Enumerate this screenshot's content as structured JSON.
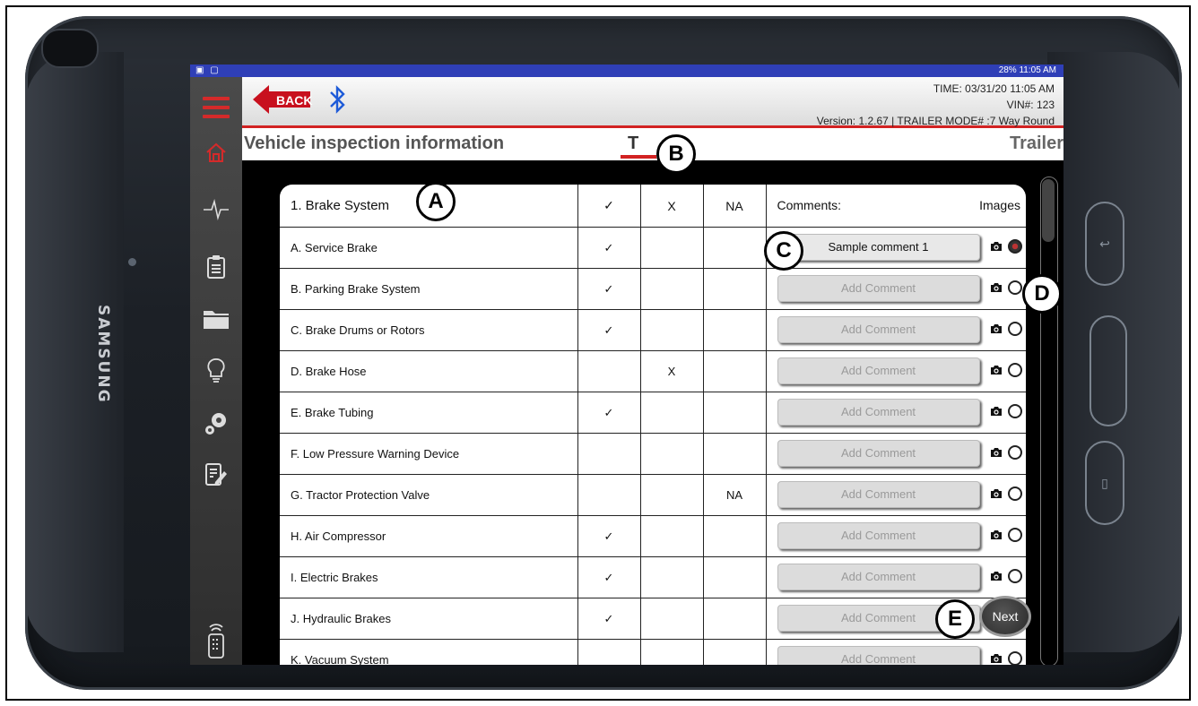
{
  "device": {
    "brand": "SAMSUNG"
  },
  "status_bar": {
    "right": "28% 11:05 AM"
  },
  "header": {
    "back_label": "BACK",
    "time": "TIME: 03/31/20 11:05 AM",
    "vin": "VIN#: 123",
    "version": "Version: 1.2.67 |  TRAILER MODE# :7 Way Round"
  },
  "title_bar": {
    "page_title": "Vehicle inspection information",
    "active_tab": "T",
    "right_tab": "Trailer"
  },
  "table": {
    "header": {
      "item": "1. Brake System",
      "ok": "✓",
      "defect": "X",
      "na": "NA",
      "comments": "Comments:",
      "images": "Images"
    },
    "rows": [
      {
        "item": "A. Service Brake",
        "ok": "✓",
        "defect": "",
        "na": "",
        "comment": "Sample comment 1",
        "image_selected": true
      },
      {
        "item": "B. Parking Brake System",
        "ok": "✓",
        "defect": "",
        "na": "",
        "comment": "Add Comment",
        "image_selected": false
      },
      {
        "item": "C. Brake Drums or Rotors",
        "ok": "✓",
        "defect": "",
        "na": "",
        "comment": "Add Comment",
        "image_selected": false
      },
      {
        "item": "D. Brake Hose",
        "ok": "",
        "defect": "X",
        "na": "",
        "comment": "Add Comment",
        "image_selected": false
      },
      {
        "item": "E. Brake Tubing",
        "ok": "✓",
        "defect": "",
        "na": "",
        "comment": "Add Comment",
        "image_selected": false
      },
      {
        "item": "F. Low Pressure Warning Device",
        "ok": "",
        "defect": "",
        "na": "",
        "comment": "Add Comment",
        "image_selected": false
      },
      {
        "item": "G. Tractor Protection Valve",
        "ok": "",
        "defect": "",
        "na": "NA",
        "comment": "Add Comment",
        "image_selected": false
      },
      {
        "item": "H. Air Compressor",
        "ok": "✓",
        "defect": "",
        "na": "",
        "comment": "Add Comment",
        "image_selected": false
      },
      {
        "item": "I. Electric Brakes",
        "ok": "✓",
        "defect": "",
        "na": "",
        "comment": "Add Comment",
        "image_selected": false
      },
      {
        "item": "J. Hydraulic Brakes",
        "ok": "✓",
        "defect": "",
        "na": "",
        "comment": "Add Comment",
        "image_selected": false
      },
      {
        "item": "K. Vacuum System",
        "ok": "",
        "defect": "",
        "na": "",
        "comment": "Add Comment",
        "image_selected": false
      }
    ]
  },
  "next_label": "Next",
  "callouts": {
    "a": "A",
    "b": "B",
    "c": "C",
    "d": "D",
    "e": "E"
  }
}
